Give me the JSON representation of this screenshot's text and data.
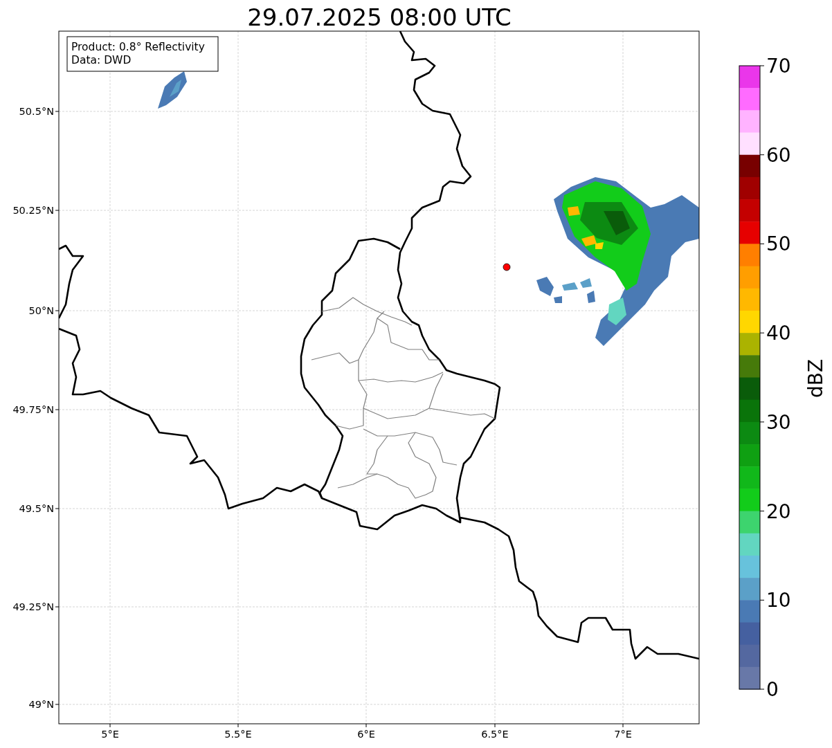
{
  "title": "29.07.2025 08:00 UTC",
  "info_box": {
    "lines": [
      "Product: 0.8° Reflectivity",
      "Data: DWD"
    ]
  },
  "x_ticks": [
    "5°E",
    "5.5°E",
    "6°E",
    "6.5°E",
    "7°E"
  ],
  "y_ticks": [
    "50.5°N",
    "50.25°N",
    "50°N",
    "49.75°N",
    "49.5°N",
    "49.25°N",
    "49°N"
  ],
  "colorbar": {
    "label": "dBZ",
    "ticks": [
      "70",
      "60",
      "50",
      "40",
      "30",
      "20",
      "10",
      "0"
    ],
    "segments": [
      {
        "color": "#ea36ea"
      },
      {
        "color": "#ff6bff"
      },
      {
        "color": "#ffb3ff"
      },
      {
        "color": "#ffe0ff"
      },
      {
        "color": "#780000"
      },
      {
        "color": "#a00000"
      },
      {
        "color": "#c40000"
      },
      {
        "color": "#e60000"
      },
      {
        "color": "#ff7f00"
      },
      {
        "color": "#ff9e00"
      },
      {
        "color": "#ffb800"
      },
      {
        "color": "#ffd700"
      },
      {
        "color": "#abb300"
      },
      {
        "color": "#467a0a"
      },
      {
        "color": "#0a5c0a"
      },
      {
        "color": "#0a740a"
      },
      {
        "color": "#0c8a12"
      },
      {
        "color": "#0fa012"
      },
      {
        "color": "#11b81a"
      },
      {
        "color": "#12cc1a"
      },
      {
        "color": "#3dd46e"
      },
      {
        "color": "#62d6c0"
      },
      {
        "color": "#67c2dc"
      },
      {
        "color": "#5ba0c8"
      },
      {
        "color": "#4a7ab4"
      },
      {
        "color": "#4560a0"
      },
      {
        "color": "#5468a0"
      },
      {
        "color": "#6878a8"
      }
    ]
  }
}
